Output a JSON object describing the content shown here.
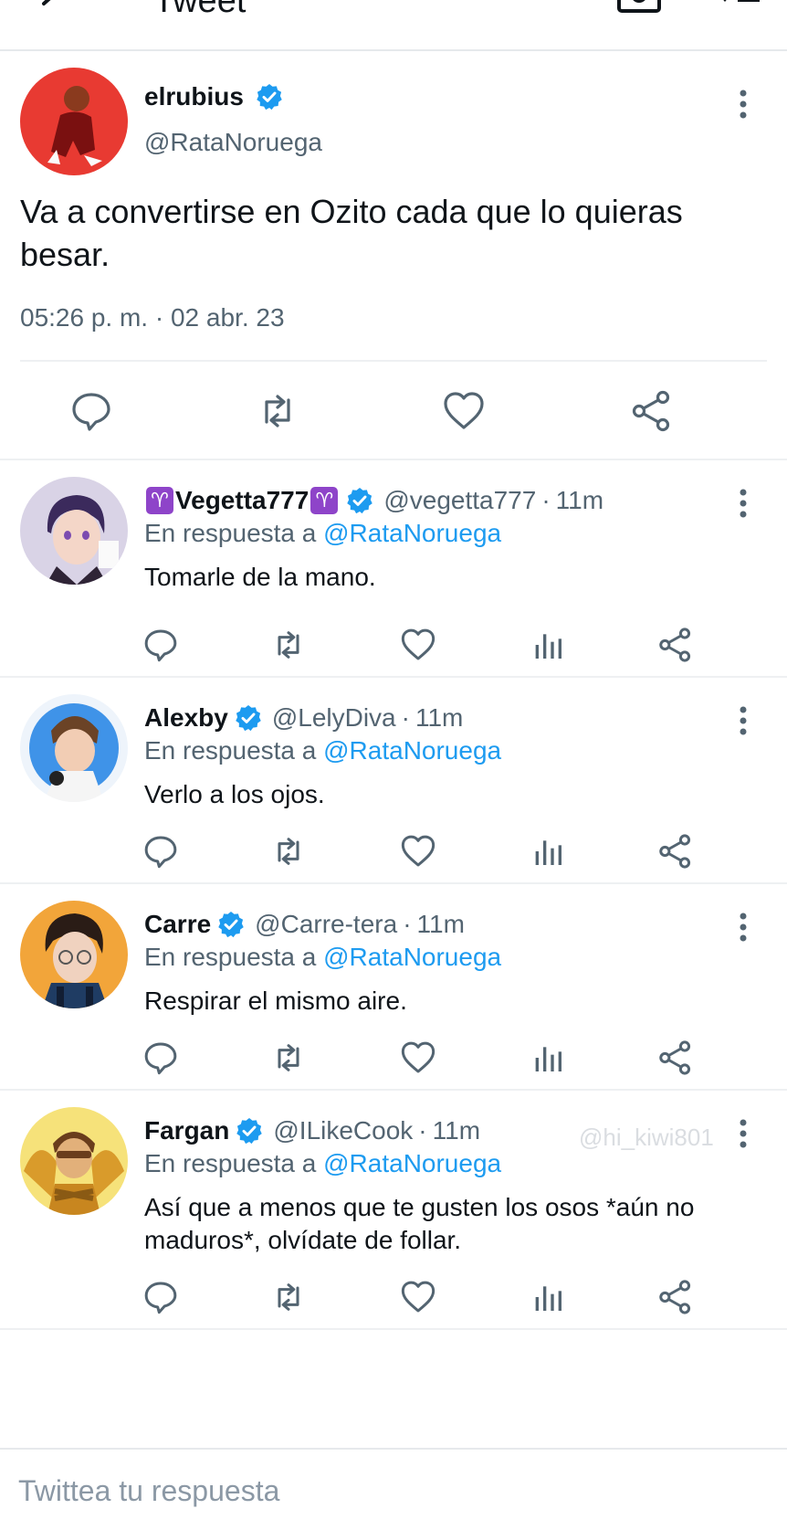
{
  "header": {
    "title": "Tweet"
  },
  "main_tweet": {
    "name": "elrubius",
    "handle": "@RataNoruega",
    "text": "Va a convertirse en Ozito cada que lo quieras besar.",
    "timestamp": "05:26 p. m. · 02 abr. 23"
  },
  "replies": [
    {
      "name": "Vegetta777",
      "name_emoji": "♈",
      "handle": "@vegetta777",
      "ago": "11m",
      "in_reply_prefix": "En respuesta a",
      "in_reply_to": "@RataNoruega",
      "text": "Tomarle de la mano."
    },
    {
      "name": "Alexby",
      "handle": "@LelyDiva",
      "ago": "11m",
      "in_reply_prefix": "En respuesta a",
      "in_reply_to": "@RataNoruega",
      "text": "Verlo a los ojos."
    },
    {
      "name": "Carre",
      "handle": "@Carre-tera",
      "ago": "11m",
      "in_reply_prefix": "En respuesta a",
      "in_reply_to": "@RataNoruega",
      "text": "Respirar el mismo aire."
    },
    {
      "name": "Fargan",
      "handle": "@ILikeCook",
      "ago": "11m",
      "in_reply_prefix": "En respuesta a",
      "in_reply_to": "@RataNoruega",
      "text": "Así que a menos que te gusten los osos *aún no maduros*, olvídate de follar."
    }
  ],
  "watermark": "@hi_kiwi801",
  "composer": {
    "placeholder": "Twittea tu respuesta"
  },
  "separator": "·",
  "colors": {
    "verified": "#1d9bf0",
    "mention": "#1d9bf0",
    "secondary_text": "#536471",
    "icon": "#536471"
  }
}
